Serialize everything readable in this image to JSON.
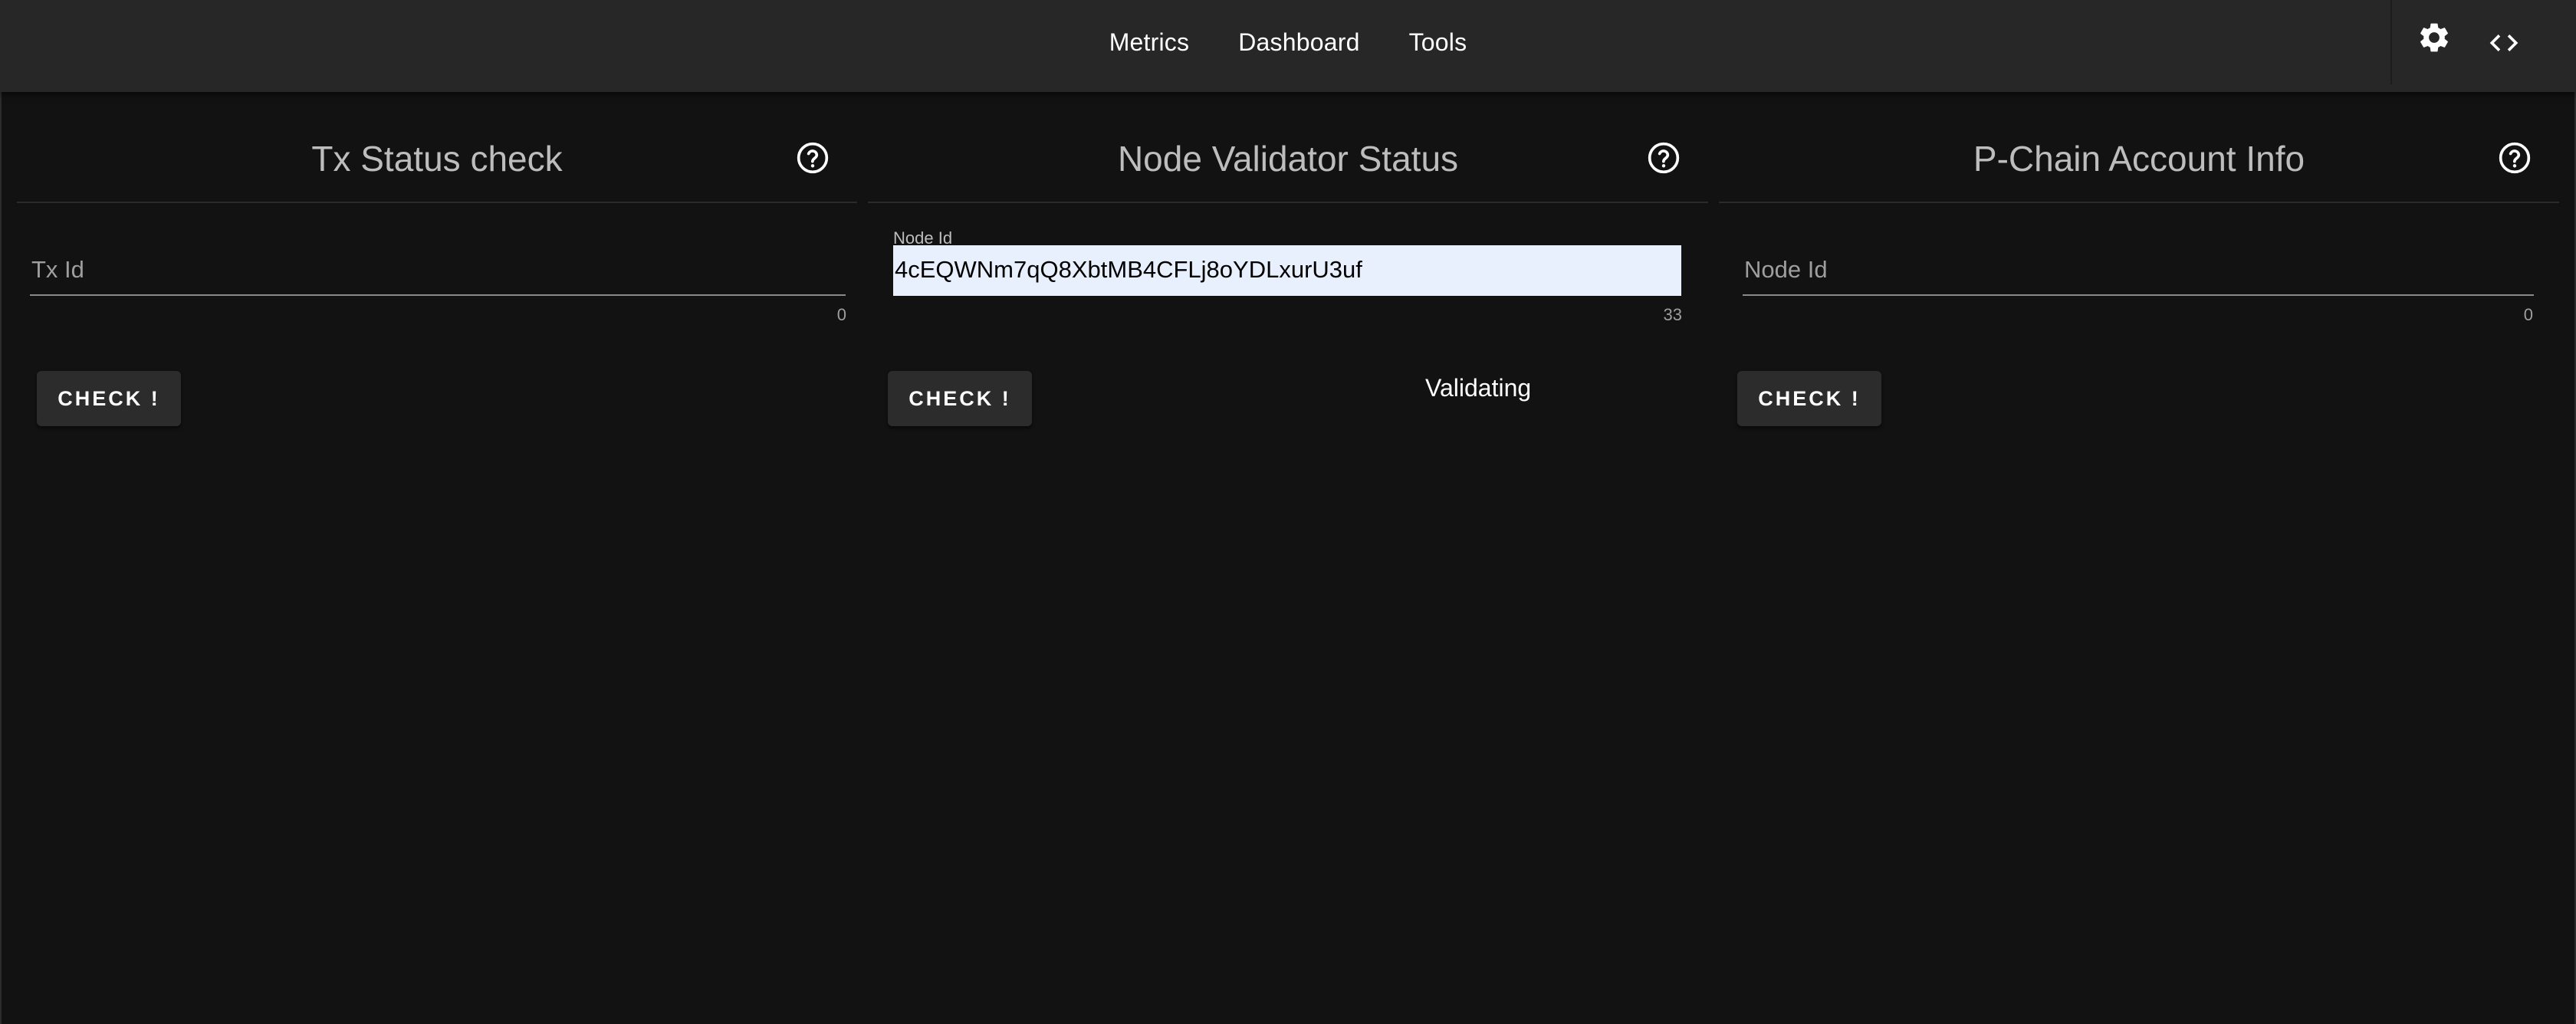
{
  "nav": {
    "items": [
      "Metrics",
      "Dashboard",
      "Tools"
    ]
  },
  "toolbar": {
    "settings_icon": "gear-icon",
    "code_icon": "code-icon"
  },
  "panels": [
    {
      "title": "Tx Status check",
      "input_placeholder": "Tx Id",
      "input_value": "",
      "counter": "0",
      "button_label": "CHECK !"
    },
    {
      "title": "Node Validator Status",
      "input_label": "Node Id",
      "input_value": "4cEQWNm7qQ8XbtMB4CFLj8oYDLxurU3uf",
      "counter": "33",
      "button_label": "CHECK !",
      "result": "Validating"
    },
    {
      "title": "P-Chain Account Info",
      "input_placeholder": "Node Id",
      "input_value": "",
      "counter": "0",
      "button_label": "CHECK !"
    }
  ],
  "colors": {
    "background": "#121212",
    "topbar": "#272727",
    "button": "#2c2c2c",
    "autofill": "#e8f0fe"
  }
}
